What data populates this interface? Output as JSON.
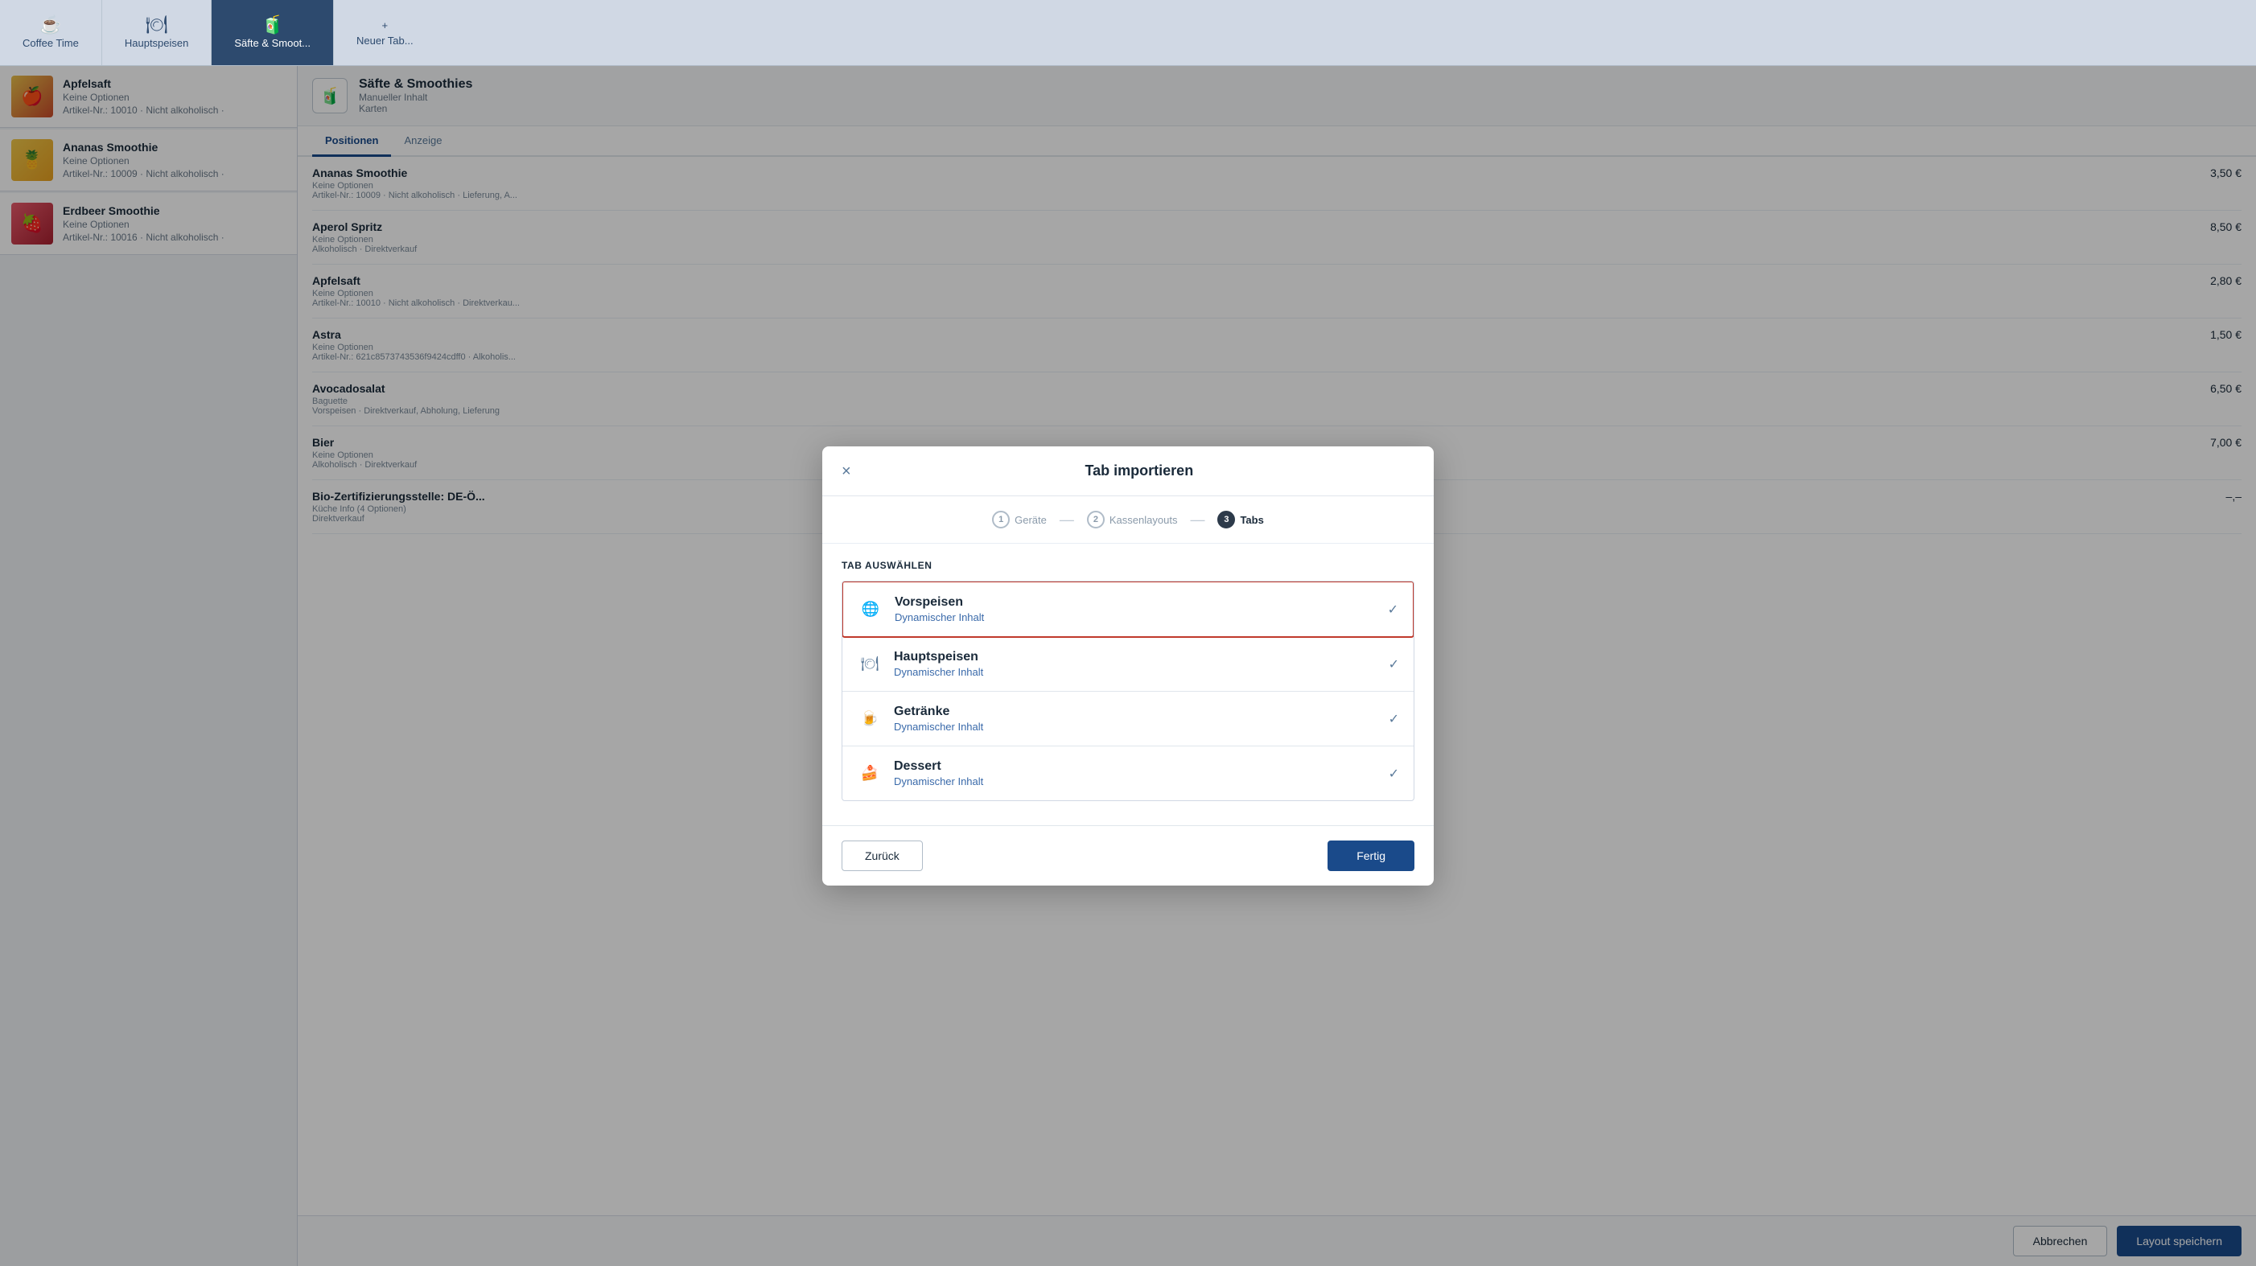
{
  "nav": {
    "tabs": [
      {
        "id": "coffee",
        "label": "Coffee Time",
        "icon": "☕",
        "active": false
      },
      {
        "id": "hauptspeisen",
        "label": "Hauptspeisen",
        "icon": "🍽",
        "active": false
      },
      {
        "id": "saefte",
        "label": "Säfte & Smoot...",
        "icon": "🧃",
        "active": true
      },
      {
        "id": "new",
        "label": "Neuer Tab...",
        "icon": "+",
        "active": false
      }
    ]
  },
  "left_list": {
    "items": [
      {
        "name": "Apfelsaft",
        "sub1": "Keine Optionen",
        "sub2": "Artikel-Nr.: 10010 · Nicht alkoholisch ·",
        "thumb": "apple"
      },
      {
        "name": "Ananas Smoothie",
        "sub1": "Keine Optionen",
        "sub2": "Artikel-Nr.: 10009 · Nicht alkoholisch ·",
        "thumb": "smoothie"
      },
      {
        "name": "Erdbeer Smoothie",
        "sub1": "Keine Optionen",
        "sub2": "Artikel-Nr.: 10016 · Nicht alkoholisch ·",
        "thumb": "strawberry"
      }
    ]
  },
  "right_panel": {
    "header": {
      "title": "Säfte & Smoothies",
      "sub1": "Manueller Inhalt",
      "sub2": "Karten"
    },
    "tabs": [
      "Positionen",
      "Anzeige"
    ],
    "active_tab": "Positionen",
    "items": [
      {
        "name": "Ananas Smoothie",
        "sub": "Keine Optionen\nArtikel-Nr.: 10009 · Nicht alkoholisch · Lieferung, A...",
        "price": "3,50 €"
      },
      {
        "name": "Aperol Spritz",
        "sub": "Keine Optionen\nAlkoholisch · Direktverkauf",
        "price": "8,50 €"
      },
      {
        "name": "Apfelsaft",
        "sub": "Keine Optionen\nArtikel-Nr.: 10010 · Nicht alkoholisch · Direktverkau...",
        "price": "2,80 €"
      },
      {
        "name": "Astra",
        "sub": "Keine Optionen\nArtikel-Nr.: 621c8573743536f9424cdff0 · Alkoholis...",
        "price": "1,50 €"
      },
      {
        "name": "Avocadosalat",
        "sub": "Baguette\nVorspeisen · Direktverkauf, Abholung, Lieferung",
        "price": "6,50 €"
      },
      {
        "name": "Bier",
        "sub": "Keine Optionen\nAlkoholisch · Direktverkauf",
        "price": "7,00 €"
      },
      {
        "name": "Bio-Zertifizierungsstelle: DE-Ö...",
        "sub": "Küche Info (4 Optionen)\nDirektverkauf",
        "price": "–,–"
      }
    ]
  },
  "bottom_bar": {
    "cancel_label": "Abbrechen",
    "save_label": "Layout speichern"
  },
  "modal": {
    "title": "Tab importieren",
    "close_icon": "×",
    "stepper": [
      {
        "num": "1",
        "label": "Geräte",
        "active": false
      },
      {
        "num": "2",
        "label": "Kassenlayouts",
        "active": false
      },
      {
        "num": "3",
        "label": "Tabs",
        "active": true
      }
    ],
    "section_label": "TAB AUSWÄHLEN",
    "items": [
      {
        "id": "vorspeisen",
        "name": "Vorspeisen",
        "sub": "Dynamischer Inhalt",
        "icon": "🌐",
        "selected": true,
        "checked": true
      },
      {
        "id": "hauptspeisen",
        "name": "Hauptspeisen",
        "sub": "Dynamischer Inhalt",
        "icon": "🍽",
        "selected": false,
        "checked": true
      },
      {
        "id": "getraenke",
        "name": "Getränke",
        "sub": "Dynamischer Inhalt",
        "icon": "🍺",
        "selected": false,
        "checked": true
      },
      {
        "id": "dessert",
        "name": "Dessert",
        "sub": "Dynamischer Inhalt",
        "icon": "🍰",
        "selected": false,
        "checked": true
      }
    ],
    "back_label": "Zurück",
    "done_label": "Fertig"
  }
}
